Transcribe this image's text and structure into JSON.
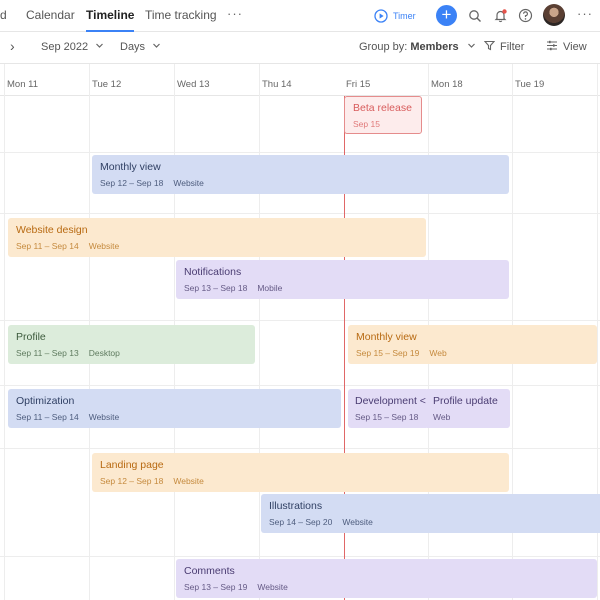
{
  "nav": {
    "tabs": [
      {
        "label": "d"
      },
      {
        "label": "Calendar"
      },
      {
        "label": "Timeline",
        "active": true
      },
      {
        "label": "Time tracking"
      }
    ],
    "more_label": "···",
    "timer_label": "Timer",
    "plus_label": "+",
    "right_more_label": "···"
  },
  "toolbar": {
    "nav_arrow": "›",
    "month_label": "Sep 2022",
    "scale_label": "Days",
    "group_prefix": "Group by:",
    "group_value": "Members",
    "filter_label": "Filter",
    "view_label": "View"
  },
  "days": [
    "Mon 11",
    "Tue 12",
    "Wed 13",
    "Thu 14",
    "Fri 15",
    "Mon 18",
    "Tue 19"
  ],
  "tasks": [
    {
      "title": "Beta release",
      "dates": "Sep 15",
      "tag": "",
      "color": "red"
    },
    {
      "title": "Monthly view",
      "dates": "Sep 12 –  Sep 18",
      "tag": "Website",
      "color": "blue"
    },
    {
      "title": "Website design",
      "dates": "Sep 11 –  Sep 14",
      "tag": "Website",
      "color": "orange"
    },
    {
      "title": "Notifications",
      "dates": "Sep 13 –  Sep 18",
      "tag": "Mobile",
      "color": "purple"
    },
    {
      "title": "Profile",
      "dates": "Sep 11 –  Sep 13",
      "tag": "Desktop",
      "color": "green"
    },
    {
      "title": "Monthly view",
      "dates": "Sep 15 –  Sep 19",
      "tag": "Web",
      "color": "orange"
    },
    {
      "title": "Optimization",
      "dates": "Sep 11 –  Sep 14",
      "tag": "Website",
      "color": "blue"
    },
    {
      "title": "Development <",
      "dates": "Sep 15 –  Sep 18",
      "tag": "",
      "color": "purple"
    },
    {
      "title": "Profile update",
      "dates": "Web",
      "tag": "",
      "color": "purple"
    },
    {
      "title": "Landing page",
      "dates": "Sep 12 –  Sep 18",
      "tag": "Website",
      "color": "orange"
    },
    {
      "title": "Illustrations",
      "dates": "Sep 14 –  Sep 20",
      "tag": "Website",
      "color": "blue"
    },
    {
      "title": "Comments",
      "dates": "Sep 13 –  Sep 19",
      "tag": "Website",
      "color": "purple"
    }
  ],
  "colors": {
    "accent": "#3b82f6",
    "today_line": "#e06767"
  }
}
